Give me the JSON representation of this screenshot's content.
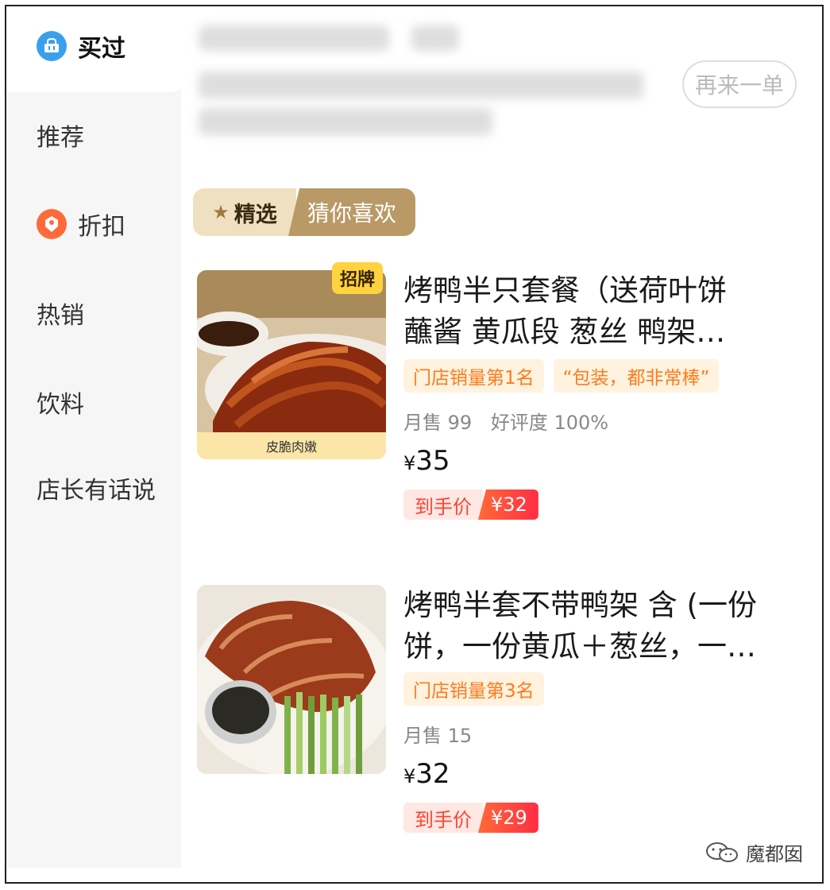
{
  "sidebar": {
    "items": [
      {
        "label": "买过",
        "icon": "basket-icon",
        "active": true
      },
      {
        "label": "推荐"
      },
      {
        "label": "折扣",
        "icon": "discount-tag-icon"
      },
      {
        "label": "热销"
      },
      {
        "label": "饮料"
      },
      {
        "label": "店长有话说"
      }
    ]
  },
  "header": {
    "reorder_label": "再来一单"
  },
  "tabs": {
    "featured": "精选",
    "guess_you_like": "猜你喜欢"
  },
  "products": [
    {
      "badge": "招牌",
      "image_caption": "皮脆肉嫩",
      "title": "烤鸭半只套餐（送荷叶饼\n蘸酱 黄瓜段 葱丝 鸭架…",
      "tags": [
        "门店销量第1名",
        "“包装，都非常棒”"
      ],
      "monthly_sales": "月售 99",
      "rating": "好评度 100%",
      "price_symbol": "¥",
      "price": "35",
      "final_label": "到手价",
      "final_price": "¥32"
    },
    {
      "title": "烤鸭半套不带鸭架 含 (一份\n饼，一份黄瓜＋葱丝，一…",
      "tags": [
        "门店销量第3名"
      ],
      "monthly_sales": "月售 15",
      "price_symbol": "¥",
      "price": "32",
      "final_label": "到手价",
      "final_price": "¥29"
    }
  ],
  "watermark": "魔都囡",
  "colors": {
    "accent_orange": "#ff7a1a",
    "price_red": "#ff2d43",
    "tab_gold": "#b99a66"
  }
}
